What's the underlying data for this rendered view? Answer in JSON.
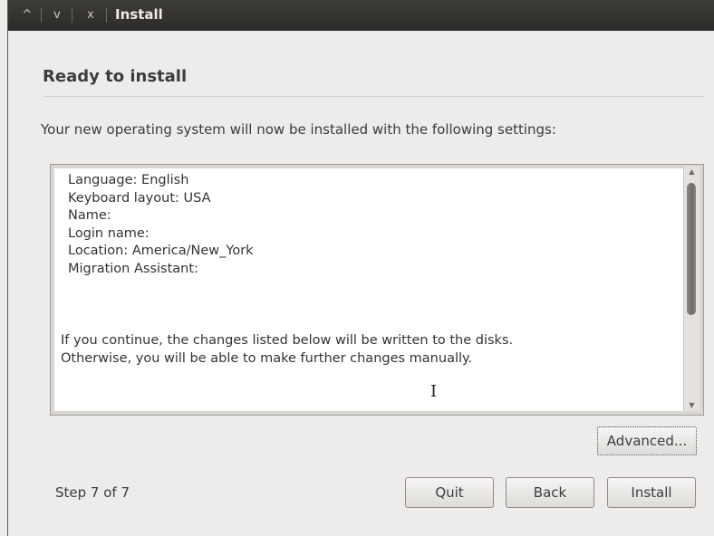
{
  "window": {
    "title": "Install",
    "controls": [
      "^",
      "v",
      "x"
    ]
  },
  "page": {
    "title": "Ready to install",
    "subtitle": "Your new operating system will now be installed with the following settings:"
  },
  "summary": {
    "settings": [
      "Language: English",
      "Keyboard layout: USA",
      "Name:",
      "Login name:",
      "Location: America/New_York",
      "Migration Assistant:"
    ],
    "notice": [
      "If you continue, the changes listed below will be written to the disks.",
      "Otherwise, you will be able to make further changes manually."
    ],
    "scroll_up": "▲",
    "scroll_down": "▼"
  },
  "buttons": {
    "advanced": "Advanced...",
    "quit": "Quit",
    "back": "Back",
    "install": "Install"
  },
  "footer": {
    "step": "Step 7 of 7"
  },
  "cursor": "I"
}
